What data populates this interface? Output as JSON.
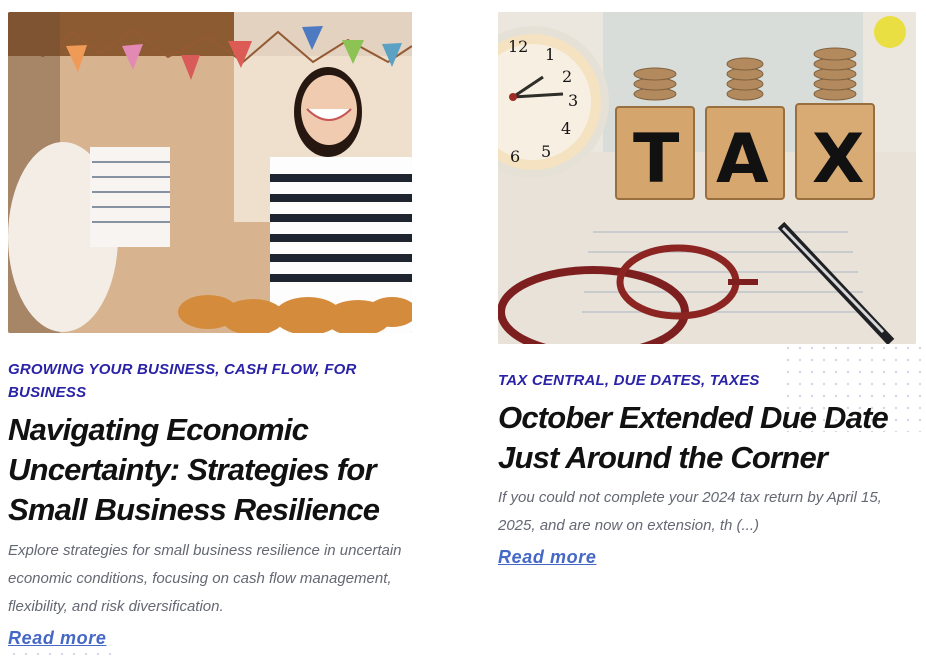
{
  "posts": [
    {
      "categories": "GROWING YOUR BUSINESS, CASH FLOW, FOR BUSINESS",
      "title": "Navigating Economic Uncertainty: Strategies for Small Business Resilience",
      "excerpt": "Explore strategies for small business resilience in uncertain economic conditions, focusing on cash flow management, flexibility, and risk diversification.",
      "read_more": "Read more",
      "image_icon": "bakery-shop-photo"
    },
    {
      "categories": "TAX CENTRAL, DUE DATES, TAXES",
      "title": "October Extended Due Date Just Around the Corner",
      "excerpt": "If you could not complete your 2024 tax return by April 15, 2025, and are now on extension, th (...)",
      "read_more": "Read more",
      "image_icon": "tax-blocks-photo",
      "image_text": "TAX"
    }
  ],
  "colors": {
    "category": "#2a23a8",
    "title": "#111111",
    "excerpt": "#656873",
    "link": "#4568c7"
  }
}
